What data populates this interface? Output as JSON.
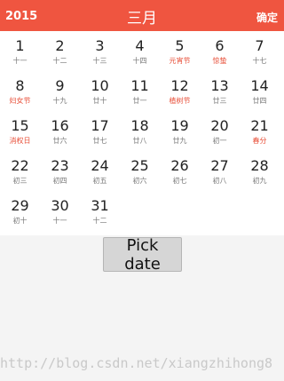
{
  "header": {
    "year": "2015",
    "month": "三月",
    "confirm_label": "确定"
  },
  "calendar": {
    "days": [
      {
        "day": "1",
        "lunar": "十一",
        "fest": false
      },
      {
        "day": "2",
        "lunar": "十二",
        "fest": false
      },
      {
        "day": "3",
        "lunar": "十三",
        "fest": false
      },
      {
        "day": "4",
        "lunar": "十四",
        "fest": false
      },
      {
        "day": "5",
        "lunar": "元宵节",
        "fest": true
      },
      {
        "day": "6",
        "lunar": "惊蛰",
        "fest": true
      },
      {
        "day": "7",
        "lunar": "十七",
        "fest": false
      },
      {
        "day": "8",
        "lunar": "妇女节",
        "fest": true
      },
      {
        "day": "9",
        "lunar": "十九",
        "fest": false
      },
      {
        "day": "10",
        "lunar": "廿十",
        "fest": false
      },
      {
        "day": "11",
        "lunar": "廿一",
        "fest": false
      },
      {
        "day": "12",
        "lunar": "植树节",
        "fest": true
      },
      {
        "day": "13",
        "lunar": "廿三",
        "fest": false
      },
      {
        "day": "14",
        "lunar": "廿四",
        "fest": false
      },
      {
        "day": "15",
        "lunar": "消权日",
        "fest": true
      },
      {
        "day": "16",
        "lunar": "廿六",
        "fest": false
      },
      {
        "day": "17",
        "lunar": "廿七",
        "fest": false
      },
      {
        "day": "18",
        "lunar": "廿八",
        "fest": false
      },
      {
        "day": "19",
        "lunar": "廿九",
        "fest": false
      },
      {
        "day": "20",
        "lunar": "初一",
        "fest": false
      },
      {
        "day": "21",
        "lunar": "春分",
        "fest": true
      },
      {
        "day": "22",
        "lunar": "初三",
        "fest": false
      },
      {
        "day": "23",
        "lunar": "初四",
        "fest": false
      },
      {
        "day": "24",
        "lunar": "初五",
        "fest": false
      },
      {
        "day": "25",
        "lunar": "初六",
        "fest": false
      },
      {
        "day": "26",
        "lunar": "初七",
        "fest": false
      },
      {
        "day": "27",
        "lunar": "初八",
        "fest": false
      },
      {
        "day": "28",
        "lunar": "初九",
        "fest": false
      },
      {
        "day": "29",
        "lunar": "初十",
        "fest": false
      },
      {
        "day": "30",
        "lunar": "十一",
        "fest": false
      },
      {
        "day": "31",
        "lunar": "十二",
        "fest": false
      }
    ],
    "festival_color": "#e8503a"
  },
  "actions": {
    "pick_date_label": "Pick date"
  },
  "watermark": "http://blog.csdn.net/xiangzhihong8",
  "colors": {
    "header": "#ef5540"
  }
}
